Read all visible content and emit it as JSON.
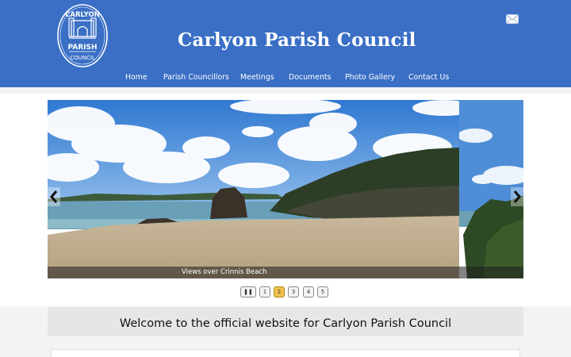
{
  "header": {
    "site_title": "Carlyon Parish Council",
    "logo": {
      "icon": "council-crest-logo",
      "text_top": "CARLYON",
      "text_mid": "PARISH",
      "text_bottom": "COUNCIL"
    },
    "mail_icon": "envelope-icon",
    "brand_color": "#3a6fc5"
  },
  "nav": {
    "items": [
      {
        "label": "Home"
      },
      {
        "label": "Parish Councillors"
      },
      {
        "label": "Meetings"
      },
      {
        "label": "Documents"
      },
      {
        "label": "Photo Gallery"
      },
      {
        "label": "Contact Us"
      }
    ]
  },
  "slider": {
    "caption": "Views over Crinnis Beach",
    "prev_icon": "chevron-left-icon",
    "next_icon": "chevron-right-icon",
    "pause_label": "❚❚",
    "pages": [
      "1",
      "2",
      "3",
      "4",
      "5"
    ],
    "active_page": "2"
  },
  "welcome": {
    "text": "Welcome to the official website for Carlyon Parish Council"
  }
}
